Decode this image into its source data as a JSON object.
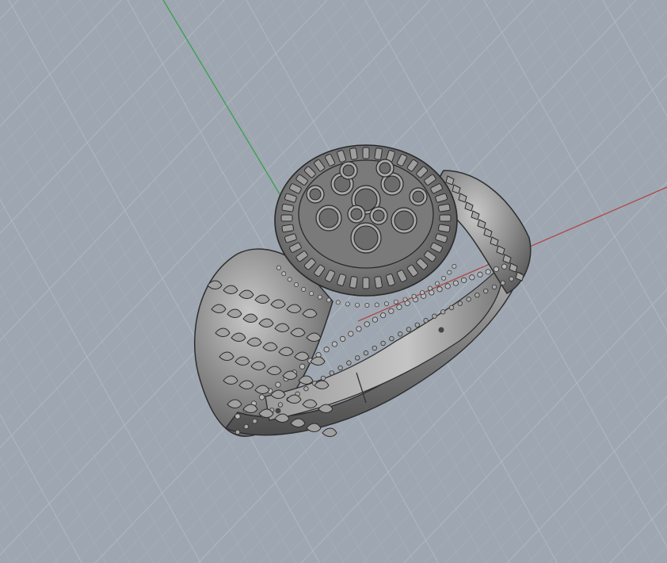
{
  "viewport": {
    "view": "Perspective",
    "background_color": "#9ea7b1",
    "grid_color": "#b3b9c1",
    "minor_grid_color": "#aab1b9",
    "x_axis_color": "#b04848",
    "y_axis_color": "#3e9e4c"
  },
  "model": {
    "name": "ring",
    "style": "shaded",
    "metal_color": "#8a8a8a"
  }
}
